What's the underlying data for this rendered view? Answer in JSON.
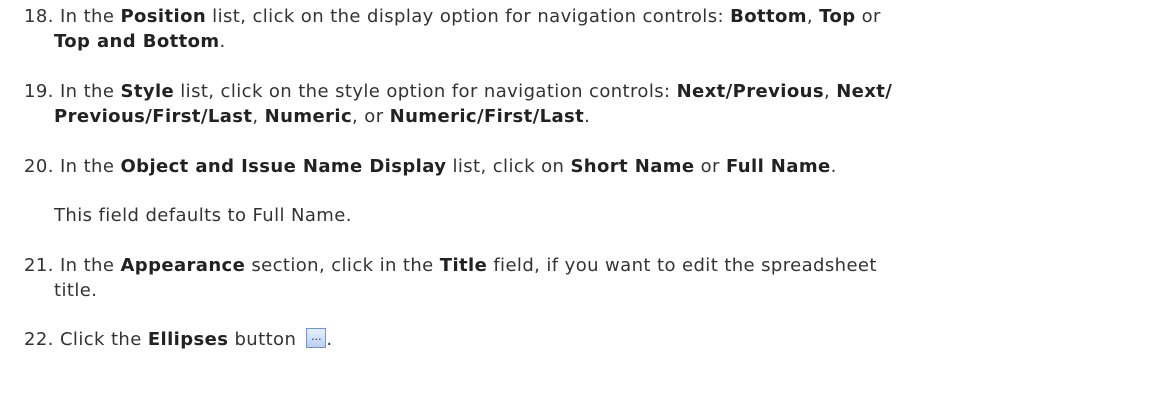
{
  "steps": [
    {
      "number": "18.",
      "line1": {
        "t1": " In the ",
        "b1": "Position",
        "t2": " list, click on the display option for navigation controls: ",
        "b2": "Bottom",
        "t3": ", ",
        "b3": "Top",
        "t4": " or"
      },
      "line2": {
        "b1": "Top and Bottom",
        "t1": "."
      }
    },
    {
      "number": "19.",
      "line1": {
        "t1": " In the ",
        "b1": "Style",
        "t2": " list, click on the style option for navigation controls: ",
        "b2": "Next/Previous",
        "t3": ", ",
        "b3": "Next/"
      },
      "line2": {
        "b1": "Previous/First/Last",
        "t1": ", ",
        "b2": "Numeric",
        "t2": ", or ",
        "b3": "Numeric/First/Last",
        "t3": "."
      }
    },
    {
      "number": "20.",
      "line1": {
        "t1": " In the ",
        "b1": "Object and Issue Name Display",
        "t2": " list, click on ",
        "b2": "Short Name",
        "t3": " or ",
        "b3": "Full Name",
        "t4": "."
      },
      "note": "This field defaults to Full Name."
    },
    {
      "number": "21.",
      "line1": {
        "t1": " In the ",
        "b1": "Appearance",
        "t2": " section, click in the ",
        "b2": "Title",
        "t3": " field, if you want to edit the spreadsheet"
      },
      "line2": {
        "t1": "title."
      }
    },
    {
      "number": "22.",
      "line1": {
        "t1": " Click the ",
        "b1": "Ellipses",
        "t2": " button "
      },
      "button_label": "...",
      "end": "."
    }
  ],
  "icons": {
    "ellipses_button": "ellipsis-button-icon"
  }
}
